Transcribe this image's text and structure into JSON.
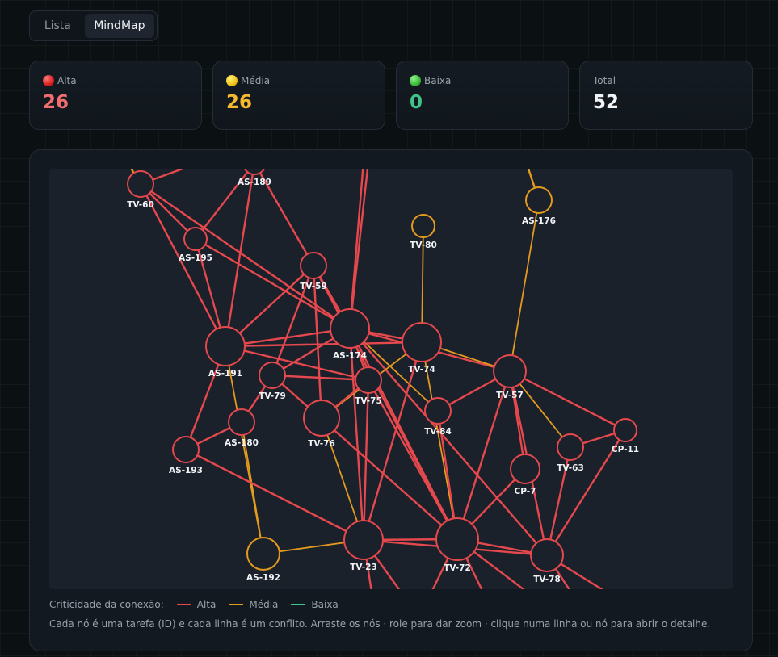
{
  "tabs": [
    {
      "label": "Lista",
      "active": false
    },
    {
      "label": "MindMap",
      "active": true
    }
  ],
  "stats": [
    {
      "label": "Alta",
      "value": "26",
      "dot": "red",
      "color": "#f26d6d"
    },
    {
      "label": "Média",
      "value": "26",
      "dot": "yellow",
      "color": "#f5b82e"
    },
    {
      "label": "Baixa",
      "value": "0",
      "dot": "green",
      "color": "#3fc58a"
    },
    {
      "label": "Total",
      "value": "52",
      "dot": "",
      "color": "#f1f3f6"
    }
  ],
  "colors": {
    "alta": "#e5484d",
    "media": "#e39a1f",
    "baixa": "#3fc58a",
    "node_fill": "#1a212b"
  },
  "graph": {
    "nodes": [
      {
        "id": "TV-60",
        "crit": "alta"
      },
      {
        "id": "AS-189",
        "crit": "alta"
      },
      {
        "id": "AS-195",
        "crit": "alta"
      },
      {
        "id": "TV-59",
        "crit": "alta"
      },
      {
        "id": "TV-80",
        "crit": "media"
      },
      {
        "id": "AS-176",
        "crit": "media"
      },
      {
        "id": "AS-174",
        "crit": "alta"
      },
      {
        "id": "TV-74",
        "crit": "alta"
      },
      {
        "id": "AS-191",
        "crit": "alta"
      },
      {
        "id": "TV-79",
        "crit": "alta"
      },
      {
        "id": "TV-75",
        "crit": "alta"
      },
      {
        "id": "TV-57",
        "crit": "alta"
      },
      {
        "id": "AS-180",
        "crit": "alta"
      },
      {
        "id": "TV-76",
        "crit": "alta"
      },
      {
        "id": "TV-84",
        "crit": "alta"
      },
      {
        "id": "CP-11",
        "crit": "alta"
      },
      {
        "id": "AS-193",
        "crit": "alta"
      },
      {
        "id": "TV-63",
        "crit": "alta"
      },
      {
        "id": "CP-7",
        "crit": "alta"
      },
      {
        "id": "AS-192",
        "crit": "media"
      },
      {
        "id": "TV-23",
        "crit": "alta"
      },
      {
        "id": "TV-72",
        "crit": "alta"
      },
      {
        "id": "TV-78",
        "crit": "alta"
      }
    ],
    "links": [
      [
        "TV-60",
        "AS-174",
        "alta"
      ],
      [
        "TV-60",
        "AS-191",
        "alta"
      ],
      [
        "TV-60",
        "AS-195",
        "alta"
      ],
      [
        "AS-189",
        "TV-59",
        "alta"
      ],
      [
        "AS-189",
        "AS-191",
        "alta"
      ],
      [
        "AS-189",
        "AS-195",
        "alta"
      ],
      [
        "AS-195",
        "AS-174",
        "alta"
      ],
      [
        "AS-195",
        "AS-191",
        "alta"
      ],
      [
        "TV-59",
        "AS-174",
        "alta"
      ],
      [
        "TV-59",
        "TV-79",
        "alta"
      ],
      [
        "TV-59",
        "TV-76",
        "alta"
      ],
      [
        "TV-59",
        "AS-191",
        "alta"
      ],
      [
        "TV-59",
        "TV-72",
        "alta"
      ],
      [
        "TV-80",
        "TV-74",
        "media"
      ],
      [
        "AS-176",
        "TV-57",
        "media"
      ],
      [
        "AS-174",
        "AS-191",
        "alta"
      ],
      [
        "AS-174",
        "TV-79",
        "alta"
      ],
      [
        "AS-174",
        "TV-74",
        "alta"
      ],
      [
        "AS-174",
        "TV-75",
        "alta"
      ],
      [
        "AS-174",
        "TV-23",
        "alta"
      ],
      [
        "AS-174",
        "TV-72",
        "alta"
      ],
      [
        "AS-174",
        "TV-78",
        "alta"
      ],
      [
        "AS-174",
        "TV-57",
        "alta"
      ],
      [
        "AS-174",
        "TV-84",
        "media"
      ],
      [
        "AS-191",
        "TV-74",
        "alta"
      ],
      [
        "AS-191",
        "TV-75",
        "alta"
      ],
      [
        "AS-191",
        "AS-193",
        "alta"
      ],
      [
        "AS-191",
        "AS-192",
        "media"
      ],
      [
        "TV-74",
        "TV-57",
        "media"
      ],
      [
        "TV-74",
        "TV-23",
        "alta"
      ],
      [
        "TV-74",
        "TV-72",
        "media"
      ],
      [
        "TV-74",
        "TV-76",
        "media"
      ],
      [
        "TV-79",
        "TV-72",
        "alta"
      ],
      [
        "TV-79",
        "AS-180",
        "alta"
      ],
      [
        "TV-79",
        "TV-75",
        "alta"
      ],
      [
        "TV-75",
        "TV-72",
        "alta"
      ],
      [
        "TV-75",
        "TV-23",
        "alta"
      ],
      [
        "TV-75",
        "TV-76",
        "alta"
      ],
      [
        "TV-57",
        "TV-84",
        "alta"
      ],
      [
        "TV-57",
        "CP-11",
        "alta"
      ],
      [
        "TV-57",
        "TV-63",
        "media"
      ],
      [
        "TV-57",
        "TV-72",
        "alta"
      ],
      [
        "TV-57",
        "TV-78",
        "alta"
      ],
      [
        "TV-57",
        "CP-7",
        "alta"
      ],
      [
        "AS-180",
        "AS-193",
        "alta"
      ],
      [
        "AS-180",
        "AS-192",
        "media"
      ],
      [
        "TV-76",
        "TV-23",
        "media"
      ],
      [
        "TV-84",
        "TV-72",
        "alta"
      ],
      [
        "CP-11",
        "TV-63",
        "alta"
      ],
      [
        "TV-63",
        "TV-78",
        "alta"
      ],
      [
        "CP-11",
        "TV-78",
        "alta"
      ],
      [
        "AS-193",
        "TV-23",
        "alta"
      ],
      [
        "AS-192",
        "TV-23",
        "media"
      ],
      [
        "TV-23",
        "TV-72",
        "alta"
      ],
      [
        "TV-72",
        "TV-78",
        "alta"
      ],
      [
        "CP-7",
        "TV-72",
        "alta"
      ],
      [
        "TV-23",
        "TV-78",
        "alta"
      ]
    ]
  },
  "legend": {
    "title": "Criticidade da conexão:",
    "items": [
      {
        "label": "Alta",
        "color": "#e5484d"
      },
      {
        "label": "Média",
        "color": "#e39a1f"
      },
      {
        "label": "Baixa",
        "color": "#3fc58a"
      }
    ]
  },
  "help_text": "Cada nó é uma tarefa (ID) e cada linha é um conflito. Arraste os nós · role para dar zoom · clique numa linha ou nó para abrir o detalhe."
}
